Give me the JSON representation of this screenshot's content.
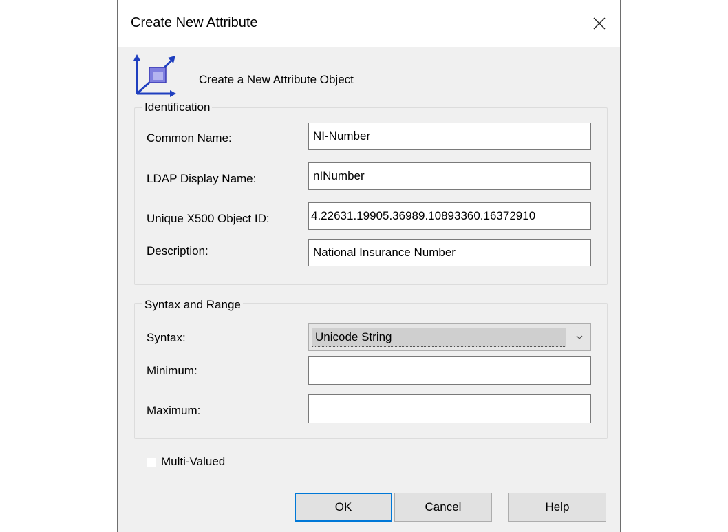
{
  "window": {
    "title": "Create New Attribute",
    "close_icon": "close-icon"
  },
  "header": {
    "icon": "attribute-object-icon",
    "text": "Create a New Attribute Object"
  },
  "identification": {
    "label": "Identification",
    "common_name": {
      "label": "Common Name:",
      "value": "NI-Number"
    },
    "ldap_display_name": {
      "label": "LDAP Display Name:",
      "value": "nINumber"
    },
    "object_id": {
      "label": "Unique X500 Object ID:",
      "value": "4.22631.19905.36989.10893360.16372910"
    },
    "description": {
      "label": "Description:",
      "value": "National Insurance Number"
    }
  },
  "syntax_range": {
    "label": "Syntax and Range",
    "syntax": {
      "label": "Syntax:",
      "selected": "Unicode String",
      "icon": "chevron-down-icon"
    },
    "minimum": {
      "label": "Minimum:",
      "value": ""
    },
    "maximum": {
      "label": "Maximum:",
      "value": ""
    }
  },
  "multi_valued": {
    "label": "Multi-Valued",
    "checked": false
  },
  "buttons": {
    "ok": "OK",
    "cancel": "Cancel",
    "help": "Help"
  },
  "colors": {
    "dialog_bg": "#f0f0f0",
    "focus_border": "#0078d7",
    "icon_blue": "#1f3fbf"
  }
}
